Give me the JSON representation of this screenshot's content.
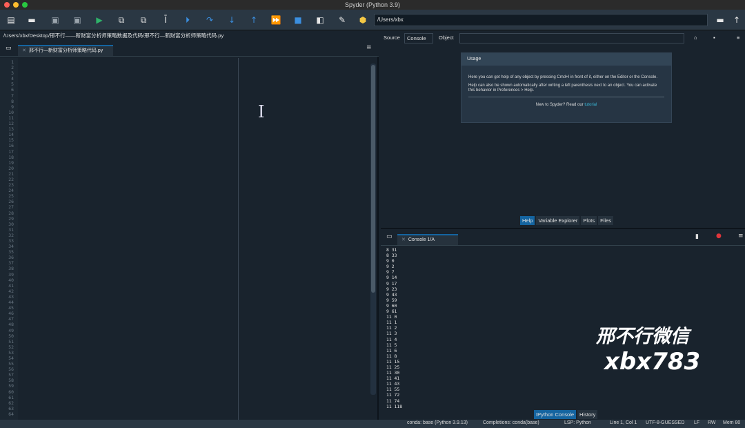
{
  "window": {
    "title": "Spyder (Python 3.9)"
  },
  "toolbar": {
    "path": "/Users/xbx",
    "icons": [
      "new-file-icon",
      "open-file-icon",
      "save-icon",
      "save-all-icon",
      "run-icon",
      "run-cell-icon",
      "run-cell-advance-icon",
      "run-selection-icon",
      "debug-icon",
      "step-icon",
      "step-into-icon",
      "step-return-icon",
      "continue-icon",
      "stop-icon",
      "maximize-icon",
      "preferences-icon",
      "python-path-icon",
      "browse-folder-icon",
      "parent-folder-icon"
    ]
  },
  "editor": {
    "file_path": "/Users/xbx/Desktop/邢不行——新财富分析师策略数据及代码/邢不行—新财富分析师策略代码.py",
    "tab_label": "邢不行—新财富分析师策略代码.py",
    "line_count": 64
  },
  "help": {
    "source_label": "Source",
    "source_value": "Console",
    "object_label": "Object",
    "usage_title": "Usage",
    "usage_p1": "Here you can get help of any object by pressing Cmd+I in front of it, either on the Editor or the Console.",
    "usage_p2": "Help can also be shown automatically after writing a left parenthesis next to an object. You can activate this behavior in Preferences > Help.",
    "usage_p3_prefix": "New to Spyder? Read our ",
    "usage_p3_link": "tutorial",
    "tabs": [
      "Help",
      "Variable Explorer",
      "Plots",
      "Files"
    ]
  },
  "console": {
    "tab_label": "Console 1/A",
    "output": [
      "8 31",
      "8 33",
      "9 0",
      "9 2",
      "9 7",
      "9 14",
      "9 17",
      "9 23",
      "9 43",
      "9 59",
      "9 60",
      "9 61",
      "11 0",
      "11 1",
      "11 2",
      "11 3",
      "11 4",
      "11 5",
      "11 6",
      "11 8",
      "11 15",
      "11 25",
      "11 30",
      "11 41",
      "11 43",
      "11 55",
      "11 72",
      "11 74",
      "11 118"
    ],
    "tabs": [
      "IPython Console",
      "History"
    ]
  },
  "watermark": {
    "line1": "邢不行微信",
    "line2": "xbx783"
  },
  "status": {
    "env": "conda: base (Python 3.9.13)",
    "completions": "Completions: conda(base)",
    "lsp": "LSP: Python",
    "position": "Line 1, Col 1",
    "encoding": "UTF-8-GUESSED",
    "eol": "LF",
    "rw": "RW",
    "mem": "Mem 80"
  },
  "colors": {
    "accent": "#1464a0",
    "background": "#19232d",
    "toolbar": "#2a3743"
  }
}
